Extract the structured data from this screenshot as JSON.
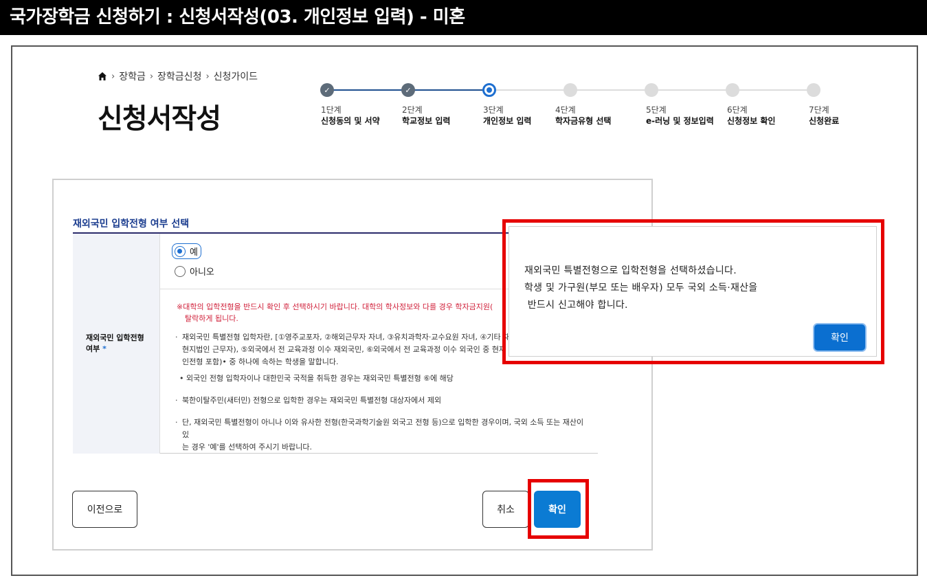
{
  "banner": {
    "title": "국가장학금 신청하기 : 신청서작성(03. 개인정보 입력) - 미혼"
  },
  "breadcrumb": {
    "items": [
      "장학금",
      "장학금신청",
      "신청가이드"
    ]
  },
  "page": {
    "title": "신청서작성"
  },
  "stepper": {
    "steps": [
      {
        "num": "1단계",
        "name": "신청동의 및 서약",
        "state": "done"
      },
      {
        "num": "2단계",
        "name": "학교정보 입력",
        "state": "done"
      },
      {
        "num": "3단계",
        "name": "개인정보 입력",
        "state": "current"
      },
      {
        "num": "4단계",
        "name": "학자금유형 선택",
        "state": "todo"
      },
      {
        "num": "5단계",
        "name": "e-러닝 및 정보입력",
        "state": "todo"
      },
      {
        "num": "6단계",
        "name": "신청정보 확인",
        "state": "todo"
      },
      {
        "num": "7단계",
        "name": "신청완료",
        "state": "todo"
      }
    ],
    "done_color": "#5d6b79",
    "current_color": "#1e6fd0"
  },
  "form": {
    "section_title": "재외국민 입학전형 여부 선택",
    "row_label_line1": "재외국민 입학전형",
    "row_label_line2": "여부",
    "required_mark": "*",
    "options": [
      {
        "label": "예",
        "checked": true
      },
      {
        "label": "아니오",
        "checked": false
      }
    ],
    "notice_line1": "※대학의 입학전형을 반드시 확인 후 선택하시기 바랍니다. 대학의 학사정보와 다를 경우 학자금지원(",
    "notice_line2": "탈락하게 됩니다.",
    "bullet1_line1": "재외국민 특별전형 입학자란, [①영주교포자, ②해외근무자 자녀, ③유치과학자·교수요원 자녀, ④기타 재",
    "bullet1_line2": "현지법인 근무자), ⑤외국에서 전 교육과정 이수 재외국민, ⑥외국에서 전 교육과정 이수 외국인 중 현재 ",
    "bullet1_line3": "인전형 포함)• 중 하나에 속하는 학생을 말합니다.",
    "sub_bullet": "외국인 전형 입학자이나 대한민국 국적을 취득한 경우는 재외국민 특별전형 ⑥에 해당",
    "bullet2": "북한이탈주민(새터민) 전형으로 입학한 경우는 재외국민 특별전형 대상자에서 제외",
    "bullet3_line1": "단, 재외국민 특별전형이 아니나 이와 유사한 전형(한국과학기술원 외국고 전형 등)으로 입학한 경우이며, 국외 소득 또는 재산이 있",
    "bullet3_line2": "는 경우 '예'를 선택하여 주시기 바랍니다."
  },
  "buttons": {
    "prev": "이전으로",
    "cancel": "취소",
    "confirm": "확인"
  },
  "modal": {
    "line1": "재외국민 특별전형으로 입학전형을 선택하셨습니다.",
    "line2": "학생 및 가구원(부모 또는 배우자) 모두 국외 소득·재산을",
    "line3": " 반드시 신고해야 합니다.",
    "confirm": "확인"
  },
  "colors": {
    "highlight": "#e60000",
    "primary_button": "#0b7bd3",
    "notice_text": "#d0203a",
    "section_title": "#1b3d8f"
  }
}
